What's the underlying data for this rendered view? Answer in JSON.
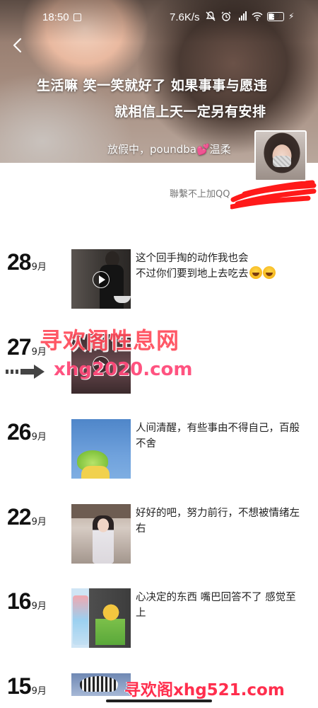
{
  "status_bar": {
    "time": "18:50",
    "network_speed": "7.6K/s",
    "battery": "39",
    "icons": [
      "app-notification-icon",
      "mute-icon",
      "alarm-icon",
      "hd-signal-icon",
      "wifi-icon",
      "battery-icon",
      "charging-icon"
    ]
  },
  "header": {
    "cover_line1": "生活嘛 笑一笑就好了 如果事事与愿违",
    "cover_line2": "就相信上天一定另有安排",
    "signature_prefix": "放假中，poundba",
    "signature_suffix": "温柔",
    "bio": "聯繫不上加QQ"
  },
  "moments": [
    {
      "day": "28",
      "month": "9月",
      "caption_lines": [
        "这个回手掏的动作我也会",
        "不过你们要到地上去吃去"
      ],
      "trailing_emoji_count": 2,
      "is_video": true
    },
    {
      "day": "27",
      "month": "9月",
      "caption_lines": [],
      "trailing_emoji_count": 0,
      "is_video": true
    },
    {
      "day": "26",
      "month": "9月",
      "caption_lines": [
        "人间清醒，有些事由不得自己，百般",
        "不舍"
      ],
      "trailing_emoji_count": 0,
      "is_video": false
    },
    {
      "day": "22",
      "month": "9月",
      "caption_lines": [
        "好好的吧，努力前行，不想被情绪左",
        "右"
      ],
      "trailing_emoji_count": 0,
      "is_video": false
    },
    {
      "day": "16",
      "month": "9月",
      "caption_lines": [
        "心决定的东西 嘴巴回答不了 感觉至",
        "上"
      ],
      "trailing_emoji_count": 0,
      "is_video": false
    },
    {
      "day": "15",
      "month": "9月",
      "caption_lines": [],
      "trailing_emoji_count": 0,
      "is_video": false
    }
  ],
  "watermarks": {
    "site_name": "寻欢阁性息网",
    "site_url": "xhg2020.com",
    "footer": "寻欢阁xhg521.com"
  },
  "colors": {
    "watermark_red": "#ff4a5a",
    "redaction_red": "#ff1a1a"
  }
}
